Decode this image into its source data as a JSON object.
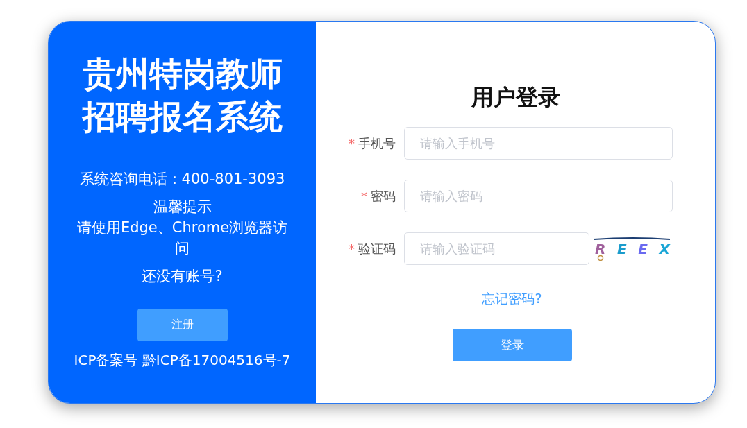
{
  "left_panel": {
    "title_lines": [
      "贵州特岗教师",
      "招聘报名系统"
    ],
    "hotline": "系统咨询电话：400-801-3093",
    "tip_title": "温馨提示",
    "tip_text": "请使用Edge、Chrome浏览器访问",
    "no_account": "还没有账号?",
    "register_button": "注册",
    "icp": "ICP备案号 黔ICP备17004516号-7"
  },
  "login": {
    "title": "用户登录",
    "fields": [
      {
        "label": "手机号",
        "required_mark": "*",
        "placeholder": "请输入手机号",
        "kind": "text"
      },
      {
        "label": "密码",
        "required_mark": "*",
        "placeholder": "请输入密码",
        "kind": "password"
      },
      {
        "label": "验证码",
        "required_mark": "*",
        "placeholder": "请输入验证码",
        "kind": "captcha"
      }
    ],
    "captcha_chars": [
      {
        "char": "R",
        "color": "#a0609c"
      },
      {
        "char": "E",
        "color": "#1a9ccc"
      },
      {
        "char": "E",
        "color": "#6a6af0"
      },
      {
        "char": "X",
        "color": "#1aa6d6"
      }
    ],
    "forgot_link": "忘记密码?",
    "login_button": "登录"
  }
}
